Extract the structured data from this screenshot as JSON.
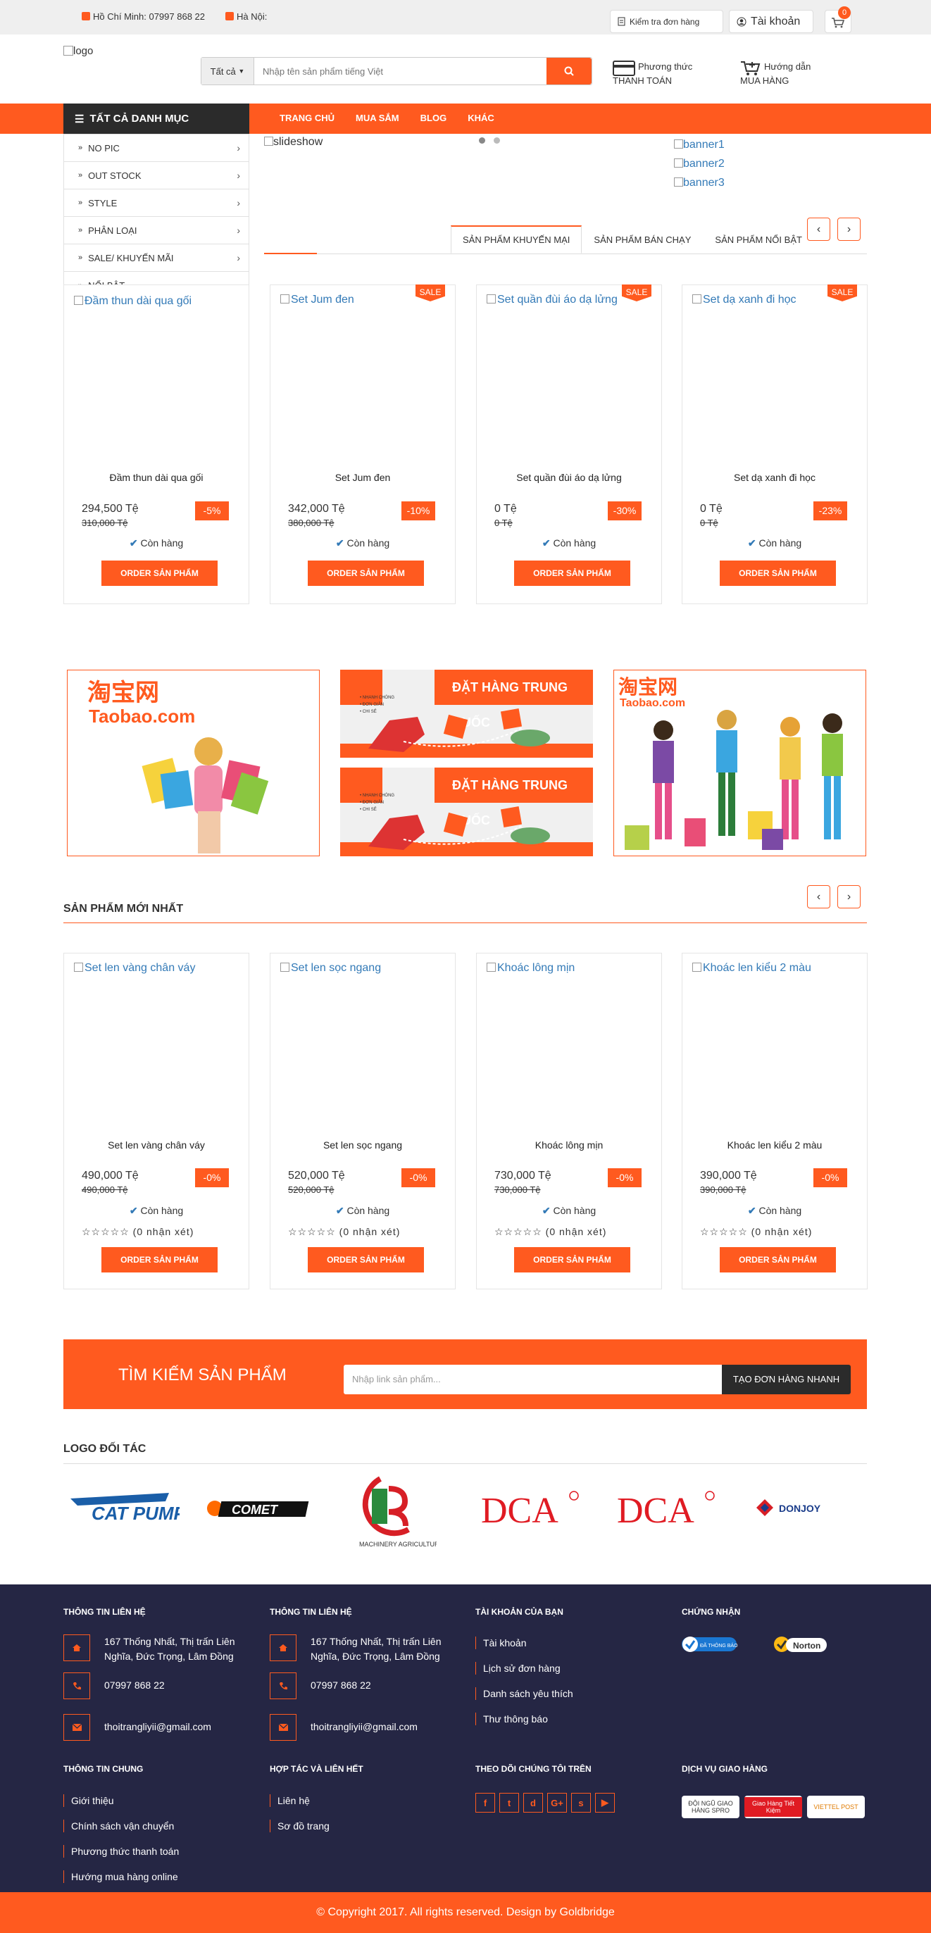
{
  "topbar": {
    "hcm": "Hồ Chí Minh: 07997 868 22",
    "hn": "Hà Nội:",
    "track_order": "Kiểm tra đơn hàng",
    "account": "Tài khoản",
    "cart_count": "0"
  },
  "header": {
    "logo_alt": "logo",
    "search_category": "Tất cả",
    "search_placeholder": "Nhập tên sản phẩm tiếng Việt",
    "payment_line1": "Phương thức",
    "payment_line2": "THANH TOÁN",
    "guide_line1": "Hướng dẫn",
    "guide_line2": "MUA HÀNG"
  },
  "nav": {
    "all_categories": "TẤT CẢ DANH MỤC",
    "links": [
      "TRANG CHỦ",
      "MUA SẮM",
      "BLOG",
      "KHÁC"
    ]
  },
  "categories": [
    "NO PIC",
    "OUT STOCK",
    "STYLE",
    "PHÂN LOẠI",
    "SALE/ KHUYẾN MÃI",
    "NỔI BẬT"
  ],
  "hero": {
    "slideshow_alt": "slideshow",
    "banners": [
      "banner1",
      "banner2",
      "banner3"
    ]
  },
  "tabs": [
    "SẢN PHẨM KHUYẾN MẠI",
    "SẢN PHẨM BÁN CHẠY",
    "SẢN PHẨM NỔI BẬT"
  ],
  "common": {
    "sale_badge": "SALE",
    "in_stock": "Còn hàng",
    "order_button": "ORDER SẢN PHẨM",
    "rating_text": "(0 nhận xét)"
  },
  "promo_products": [
    {
      "name": "Đầm thun dài qua gối",
      "price": "294,500 Tệ",
      "old_price": "310,000 Tệ",
      "discount": "-5%",
      "sale": false
    },
    {
      "name": "Set Jum đen",
      "price": "342,000 Tệ",
      "old_price": "380,000 Tệ",
      "discount": "-10%",
      "sale": true
    },
    {
      "name": "Set quần đùi áo dạ lửng",
      "price": "0 Tệ",
      "old_price": "0 Tệ",
      "discount": "-30%",
      "sale": true
    },
    {
      "name": "Set dạ xanh đi học",
      "price": "0 Tệ",
      "old_price": "0 Tệ",
      "discount": "-23%",
      "sale": true
    }
  ],
  "ads": {
    "taobao1": "淘宝网",
    "taobao1_sub": "Taobao.com",
    "order_cn": "ĐẶT HÀNG TRUNG QUỐC",
    "order_cn_bullets": [
      "• NHANH CHÓNG",
      "• ĐƠN GIẢN",
      "• CHI SẺ"
    ],
    "taobao2": "淘宝网",
    "taobao2_sub": "Taobao.com"
  },
  "new_section": {
    "title": "SẢN PHẨM MỚI NHẤT"
  },
  "new_products": [
    {
      "name": "Set len vàng chân váy",
      "price": "490,000 Tệ",
      "old_price": "490,000 Tệ",
      "discount": "-0%"
    },
    {
      "name": "Set len sọc ngang",
      "price": "520,000 Tệ",
      "old_price": "520,000 Tệ",
      "discount": "-0%"
    },
    {
      "name": "Khoác lông mịn",
      "price": "730,000 Tệ",
      "old_price": "730,000 Tệ",
      "discount": "-0%"
    },
    {
      "name": "Khoác len kiểu 2 màu",
      "price": "390,000 Tệ",
      "old_price": "390,000 Tệ",
      "discount": "-0%"
    }
  ],
  "search_band": {
    "title": "TÌM KIẾM SẢN PHẨM",
    "placeholder": "Nhập link sản phẩm...",
    "button": "TẠO ĐƠN HÀNG NHANH"
  },
  "partners": {
    "title": "LOGO ĐỐI TÁC",
    "logos": [
      "CAT PUMPS",
      "COMET",
      "MACHINERY AGRICULTURAL",
      "DCA",
      "DCA",
      "DONJOY"
    ]
  },
  "footer": {
    "contact1_title": "THÔNG TIN LIÊN HỆ",
    "contact2_title": "THÔNG TIN LIÊN HỆ",
    "address": "167 Thống Nhất, Thị trấn Liên Nghĩa, Đức Trọng, Lâm Đồng",
    "phone": "07997 868 22",
    "email": "thoitrangliyii@gmail.com",
    "account_title": "TÀI KHOẢN CỦA BẠN",
    "account_links": [
      "Tài khoản",
      "Lịch sử đơn hàng",
      "Danh sách yêu thích",
      "Thư thông báo"
    ],
    "cert_title": "CHỨNG NHẬN",
    "cert_labels": [
      "ĐÃ THÔNG BÁO",
      "Norton"
    ],
    "general_title": "THÔNG TIN CHUNG",
    "general_links": [
      "Giới thiệu",
      "Chính sách vận chuyển",
      "Phương thức thanh toán",
      "Hướng mua hàng online"
    ],
    "partner_title": "HỢP TÁC VÀ LIÊN HẾT",
    "partner_links": [
      "Liên hệ",
      "Sơ đồ trang"
    ],
    "follow_title": "THEO DÕI CHÚNG TÔI TRÊN",
    "social": [
      "f",
      "t",
      "d",
      "G+",
      "s",
      "▶"
    ],
    "delivery_title": "DỊCH VỤ GIAO HÀNG",
    "delivery_logos": [
      "ĐỘI NGŨ GIAO HÀNG SPRO",
      "Giao Hàng Tiết Kiệm",
      "VIETTEL POST"
    ],
    "copyright": "© Copyright 2017. All rights reserved. Design by Goldbridge"
  },
  "colors": {
    "accent": "#ff5a1f",
    "dark": "#2b2b2b",
    "footer": "#252644"
  }
}
